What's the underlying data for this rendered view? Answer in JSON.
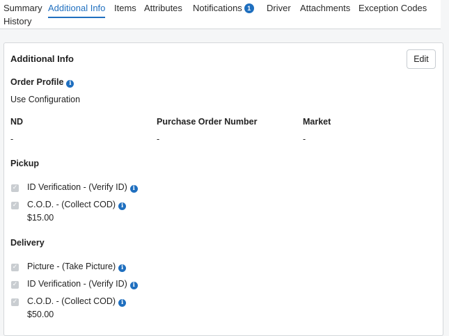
{
  "tabs": {
    "summary": "Summary",
    "additional_info": "Additional Info",
    "items": "Items",
    "attributes": "Attributes",
    "notifications": "Notifications",
    "notifications_count": "1",
    "driver": "Driver",
    "attachments": "Attachments",
    "exception_codes": "Exception Codes",
    "history": "History"
  },
  "card": {
    "title": "Additional Info",
    "edit_label": "Edit",
    "order_profile": {
      "label": "Order Profile",
      "value": "Use Configuration"
    },
    "fields": [
      {
        "label": "ND",
        "value": "-"
      },
      {
        "label": "Purchase Order Number",
        "value": "-"
      },
      {
        "label": "Market",
        "value": "-"
      }
    ],
    "pickup": {
      "title": "Pickup",
      "items": [
        {
          "label": "ID Verification - (Verify ID)",
          "checked": true
        },
        {
          "label": "C.O.D. - (Collect COD)",
          "checked": true,
          "amount": "$15.00"
        }
      ]
    },
    "delivery": {
      "title": "Delivery",
      "items": [
        {
          "label": "Picture - (Take Picture)",
          "checked": true
        },
        {
          "label": "ID Verification - (Verify ID)",
          "checked": true
        },
        {
          "label": "C.O.D. - (Collect COD)",
          "checked": true,
          "amount": "$50.00"
        }
      ]
    }
  },
  "icons": {
    "info": "info-icon",
    "check": "checkbox-checked-icon"
  },
  "colors": {
    "accent": "#1f6fbf",
    "checkbox_disabled": "#c9cdd1"
  }
}
